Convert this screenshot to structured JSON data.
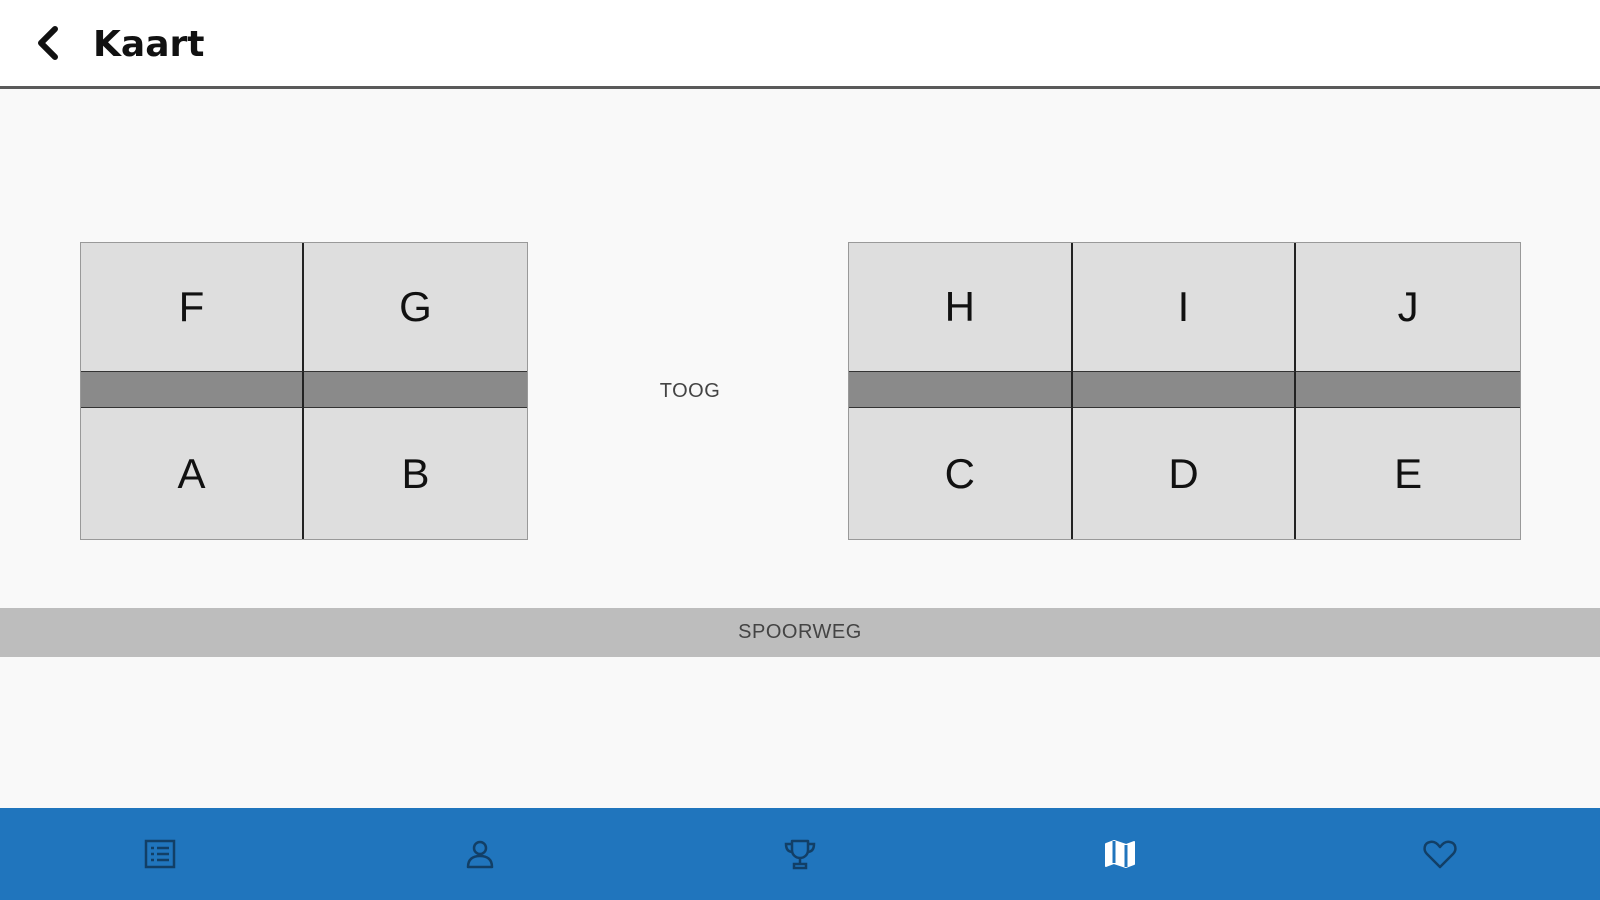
{
  "header": {
    "title": "Kaart",
    "back_icon": "arrow-back-icon"
  },
  "map": {
    "left_block": {
      "top_row": [
        "F",
        "G"
      ],
      "bottom_row": [
        "A",
        "B"
      ]
    },
    "right_block": {
      "top_row": [
        "H",
        "I",
        "J"
      ],
      "bottom_row": [
        "C",
        "D",
        "E"
      ]
    },
    "bar_label": "TOOG",
    "railway_label": "SPOORWEG"
  },
  "bottom_nav": {
    "items": [
      {
        "icon": "list-icon",
        "active": false
      },
      {
        "icon": "person-icon",
        "active": false
      },
      {
        "icon": "trophy-icon",
        "active": false
      },
      {
        "icon": "map-icon",
        "active": true
      },
      {
        "icon": "heart-icon",
        "active": false
      }
    ]
  },
  "colors": {
    "nav_background": "#2075bd",
    "nav_icon_inactive": "#123f66",
    "nav_icon_active": "#ffffff",
    "cell_background": "#dedede",
    "aisle": "#8a8a8a",
    "railway": "#bdbdbd"
  }
}
